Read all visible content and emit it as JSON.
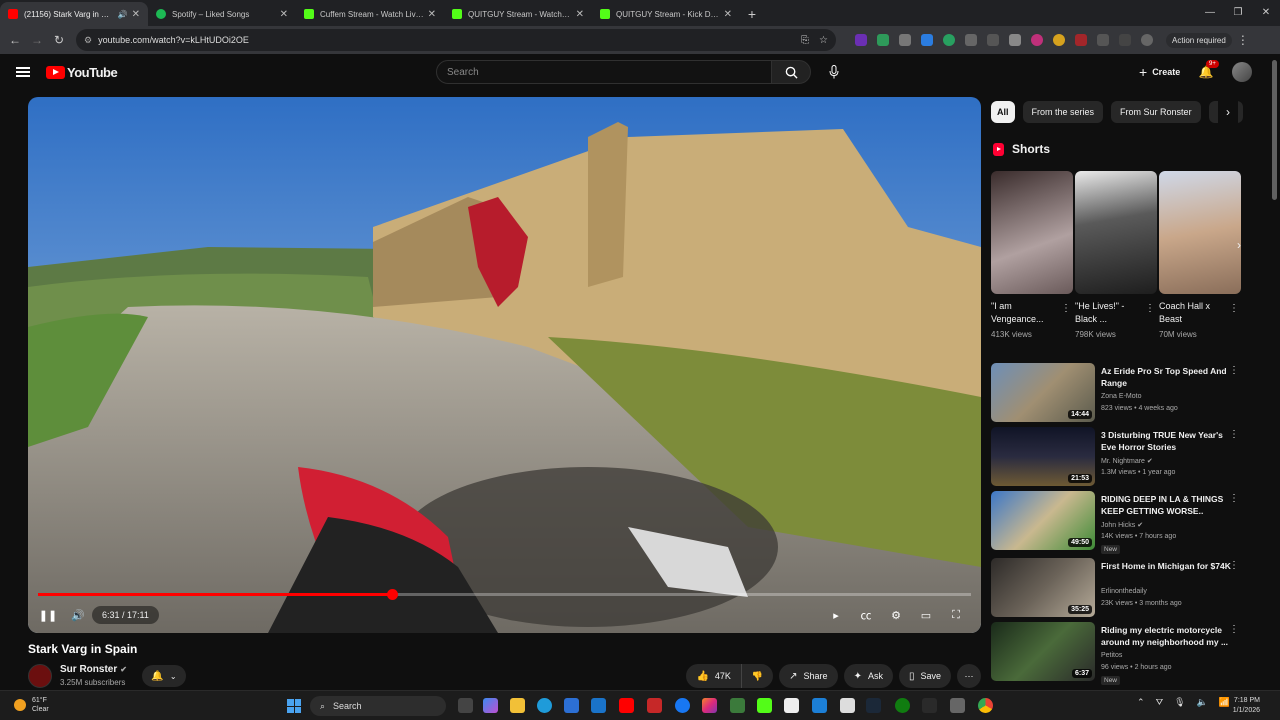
{
  "browser": {
    "tabs": [
      {
        "title": "(21156) Stark Varg in Spain",
        "favicon_color": "#ff0000",
        "active": true,
        "audio": true
      },
      {
        "title": "Spotify – Liked Songs",
        "favicon_color": "#1db954",
        "active": false
      },
      {
        "title": "Cuffem Stream - Watch Live on",
        "favicon_color": "#53fc18",
        "active": false
      },
      {
        "title": "QUITGUY Stream - Watch Live",
        "favicon_color": "#53fc18",
        "active": false
      },
      {
        "title": "QUITGUY Stream - Kick Dashbo",
        "favicon_color": "#53fc18",
        "active": false
      }
    ],
    "url": "youtube.com/watch?v=kLHtUDOi2OE",
    "action_required": "Action required"
  },
  "youtube": {
    "logo_text": "YouTube",
    "search_placeholder": "Search",
    "create_label": "Create",
    "notification_badge": "9+",
    "accent": "#ff0000"
  },
  "player": {
    "time_current": "6:31",
    "time_total": "17:11",
    "time_display": "6:31 / 17:11",
    "progress_fraction": 0.379
  },
  "video": {
    "title": "Stark Varg in Spain",
    "channel": "Sur Ronster",
    "subscribers": "3.25M subscribers",
    "likes": "47K",
    "share_label": "Share",
    "ask_label": "Ask",
    "save_label": "Save"
  },
  "sidebar": {
    "chips": [
      "All",
      "From the series",
      "From Sur Ronster",
      "E-M"
    ],
    "shorts_heading": "Shorts",
    "shorts": [
      {
        "title": "\"I am Vengeance...",
        "views": "413K views"
      },
      {
        "title": "\"He Lives!\" - Black ...",
        "views": "798K views"
      },
      {
        "title": "Coach Hall x Beast",
        "views": "70M views"
      }
    ],
    "recommendations": [
      {
        "title": "Az Eride Pro Sr Top Speed And Range",
        "channel": "Zona E-Moto",
        "meta": "823 views • 4 weeks ago",
        "duration": "14:44",
        "new": ""
      },
      {
        "title": "3 Disturbing TRUE New Year's Eve Horror Stories",
        "channel": "Mr. Nightmare",
        "meta": "1.3M views • 1 year ago",
        "duration": "21:53",
        "new": ""
      },
      {
        "title": "RIDING DEEP IN LA & THINGS KEEP GETTING WORSE..",
        "channel": "John Hicks",
        "meta": "14K views • 7 hours ago",
        "duration": "49:50",
        "new": "New"
      },
      {
        "title": "First Home in Michigan for $74K",
        "channel": "Erlinonthedaily",
        "meta": "23K views • 3 months ago",
        "duration": "35:25",
        "new": ""
      },
      {
        "title": "Riding my electric motorcycle around my neighborhood my ...",
        "channel": "Petitos",
        "meta": "96 views • 2 hours ago",
        "duration": "6:37",
        "new": "New"
      }
    ]
  },
  "taskbar": {
    "temperature": "61°F",
    "weather": "Clear",
    "search_label": "Search",
    "time": "7:18 PM",
    "date": "1/1/2026"
  }
}
